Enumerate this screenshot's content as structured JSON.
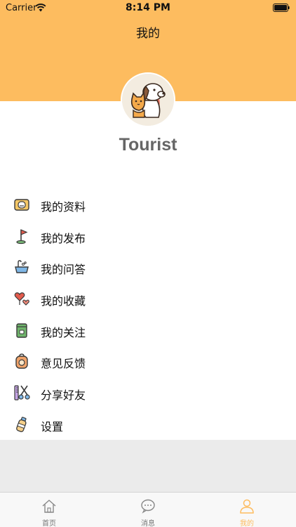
{
  "status_bar": {
    "carrier": "Carrier",
    "time": "8:14 PM"
  },
  "nav": {
    "title": "我的"
  },
  "profile": {
    "username": "Tourist",
    "avatar_icon": "dog-cat-avatar-icon"
  },
  "menu": {
    "items": [
      {
        "label": "我的资料",
        "icon": "profile-card-icon"
      },
      {
        "label": "我的发布",
        "icon": "flag-icon"
      },
      {
        "label": "我的问答",
        "icon": "bathtub-icon"
      },
      {
        "label": "我的收藏",
        "icon": "hearts-icon"
      },
      {
        "label": "我的关注",
        "icon": "food-bag-icon"
      },
      {
        "label": "意见反馈",
        "icon": "backpack-icon"
      },
      {
        "label": "分享好友",
        "icon": "grooming-tools-icon"
      },
      {
        "label": "设置",
        "icon": "bottle-icon"
      }
    ]
  },
  "tab_bar": {
    "tabs": [
      {
        "label": "首页",
        "icon": "home-icon",
        "active": false
      },
      {
        "label": "消息",
        "icon": "chat-icon",
        "active": false
      },
      {
        "label": "我的",
        "icon": "person-icon",
        "active": true
      }
    ]
  },
  "colors": {
    "header": "#fdbc5f",
    "accent": "#fdbc5f",
    "username": "#666666",
    "gray_area": "#ebebeb"
  }
}
